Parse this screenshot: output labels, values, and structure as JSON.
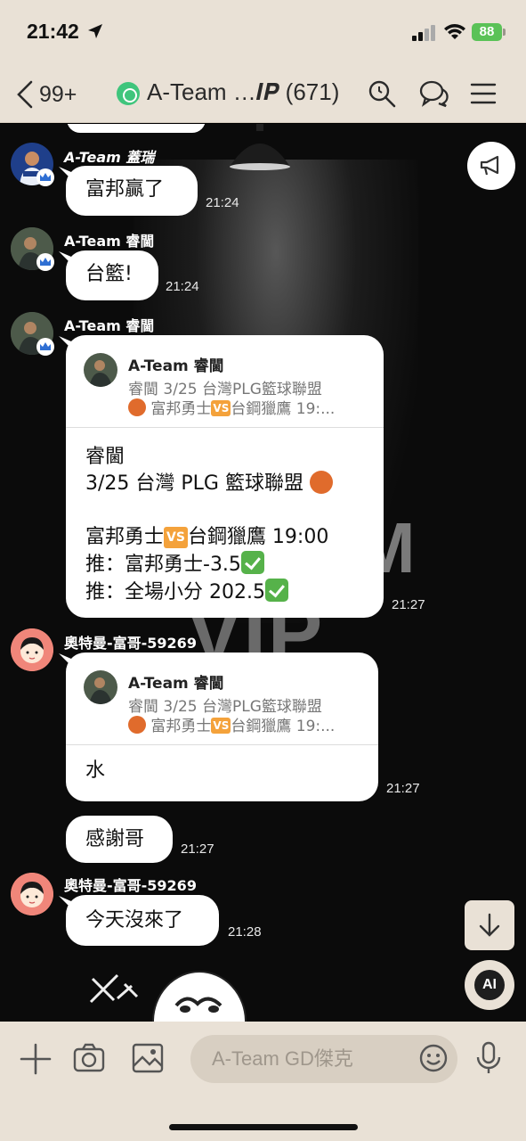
{
  "status_bar": {
    "time": "21:42",
    "battery": "88"
  },
  "header": {
    "back_count": "99+",
    "title": "A-Team …𝑰𝑷 (671)"
  },
  "messages": [
    {
      "sender": "A-Team 蓋瑞",
      "text": "富邦贏了",
      "time": "21:24"
    },
    {
      "sender": "A-Team 睿閫",
      "text": "台籃!",
      "time": "21:24"
    },
    {
      "sender": "A-Team 睿閫",
      "reply": {
        "name": "A-Team 睿閫",
        "line1": "睿閫 3/25 台灣PLG籃球聯盟",
        "line2a": "富邦勇士",
        "line2b": "台鋼獵鷹 19:..."
      },
      "body": {
        "l1": "睿閫",
        "l2": "3/25 台灣 PLG 籃球聯盟",
        "l3a": "富邦勇士",
        "l3b": "台鋼獵鷹 19:00",
        "l4": "推：富邦勇士-3.5",
        "l5": "推：全場小分 202.5"
      },
      "time": "21:27"
    },
    {
      "sender": "奧特曼-富哥-59269",
      "reply": {
        "name": "A-Team 睿閫",
        "line1": "睿閫 3/25 台灣PLG籃球聯盟",
        "line2a": "富邦勇士",
        "line2b": "台鋼獵鷹 19:..."
      },
      "text": "水",
      "time": "21:27"
    },
    {
      "text": "感謝哥",
      "time": "21:27"
    },
    {
      "sender": "奧特曼-富哥-59269",
      "text": "今天沒來了",
      "time": "21:28"
    }
  ],
  "emoji": {
    "vs": "VS"
  },
  "floating": {
    "ai_label": "AI"
  },
  "input": {
    "placeholder": "A-Team GD傑克"
  }
}
